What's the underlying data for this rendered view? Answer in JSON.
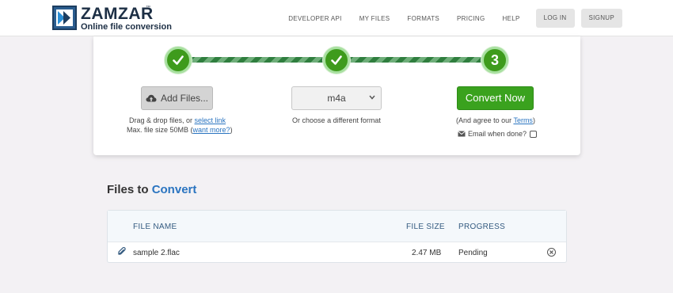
{
  "header": {
    "logo_text": "ZAMZAR",
    "logo_tm": "™",
    "logo_sub": "Online file conversion",
    "nav": [
      "DEVELOPER API",
      "MY FILES",
      "FORMATS",
      "PRICING",
      "HELP"
    ],
    "login": "LOG IN",
    "signup": "SIGNUP"
  },
  "steps": {
    "step3_number": "3"
  },
  "step1": {
    "button": "Add Files...",
    "note_prefix": "Drag & drop files, or ",
    "note_link": "select link",
    "note2_prefix": "Max. file size 50MB (",
    "note2_link": "want more?",
    "note2_suffix": ")"
  },
  "step2": {
    "format_value": "m4a",
    "note": "Or choose a different format"
  },
  "step3": {
    "button": "Convert Now",
    "note_prefix": "(And agree to our ",
    "note_link": "Terms",
    "note_suffix": ")",
    "email_label": "Email when done?"
  },
  "files": {
    "title_prefix": "Files to ",
    "title_accent": "Convert",
    "columns": {
      "name": "FILE NAME",
      "size": "FILE SIZE",
      "progress": "PROGRESS"
    },
    "rows": [
      {
        "name": "sample 2.flac",
        "size": "2.47 MB",
        "progress": "Pending"
      }
    ]
  },
  "colors": {
    "accent_blue": "#2a74c0",
    "green": "#3aa21e"
  }
}
